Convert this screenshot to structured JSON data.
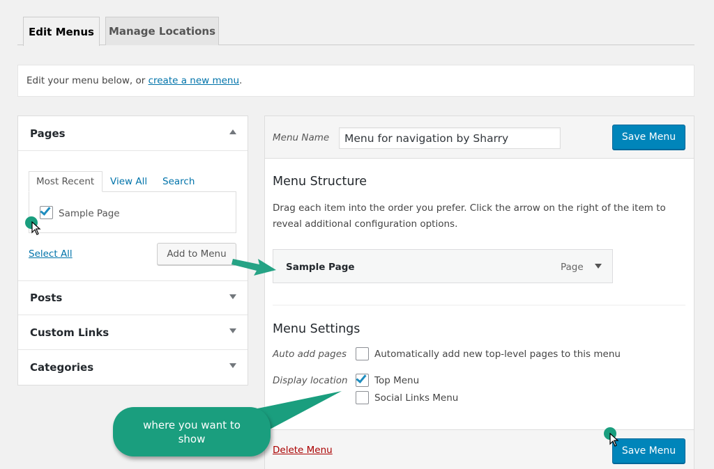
{
  "tabs": {
    "edit_menus": "Edit Menus",
    "manage_locations": "Manage Locations"
  },
  "notice": {
    "text_before": "Edit your menu below, or ",
    "link": "create a new menu",
    "text_after": "."
  },
  "left_panel": {
    "pages_title": "Pages",
    "inner_tabs": [
      "Most Recent",
      "View All",
      "Search"
    ],
    "page_item": "Sample Page",
    "page_item_checked": true,
    "select_all": "Select All",
    "add_to_menu": "Add to Menu",
    "sections": [
      "Posts",
      "Custom Links",
      "Categories"
    ]
  },
  "right_panel": {
    "menu_name_label": "Menu Name",
    "menu_name_value": "Menu for navigation by Sharry",
    "save_menu": "Save Menu",
    "structure_title": "Menu Structure",
    "structure_desc": "Drag each item into the order you prefer. Click the arrow on the right of the item to reveal additional configuration options.",
    "menu_item": {
      "title": "Sample Page",
      "type": "Page"
    },
    "settings_title": "Menu Settings",
    "auto_add_label": "Auto add pages",
    "auto_add_text": "Automatically add new top-level pages to this menu",
    "auto_add_checked": false,
    "display_location_label": "Display location",
    "locations": [
      {
        "label": "Top Menu",
        "checked": true
      },
      {
        "label": "Social Links Menu",
        "checked": false
      }
    ],
    "delete_menu": "Delete Menu"
  },
  "annotation": {
    "bubble_text": "where you want to show"
  },
  "colors": {
    "accent": "#0085ba",
    "link": "#0073aa",
    "annotation": "#1a9e7e",
    "delete": "#a00"
  }
}
